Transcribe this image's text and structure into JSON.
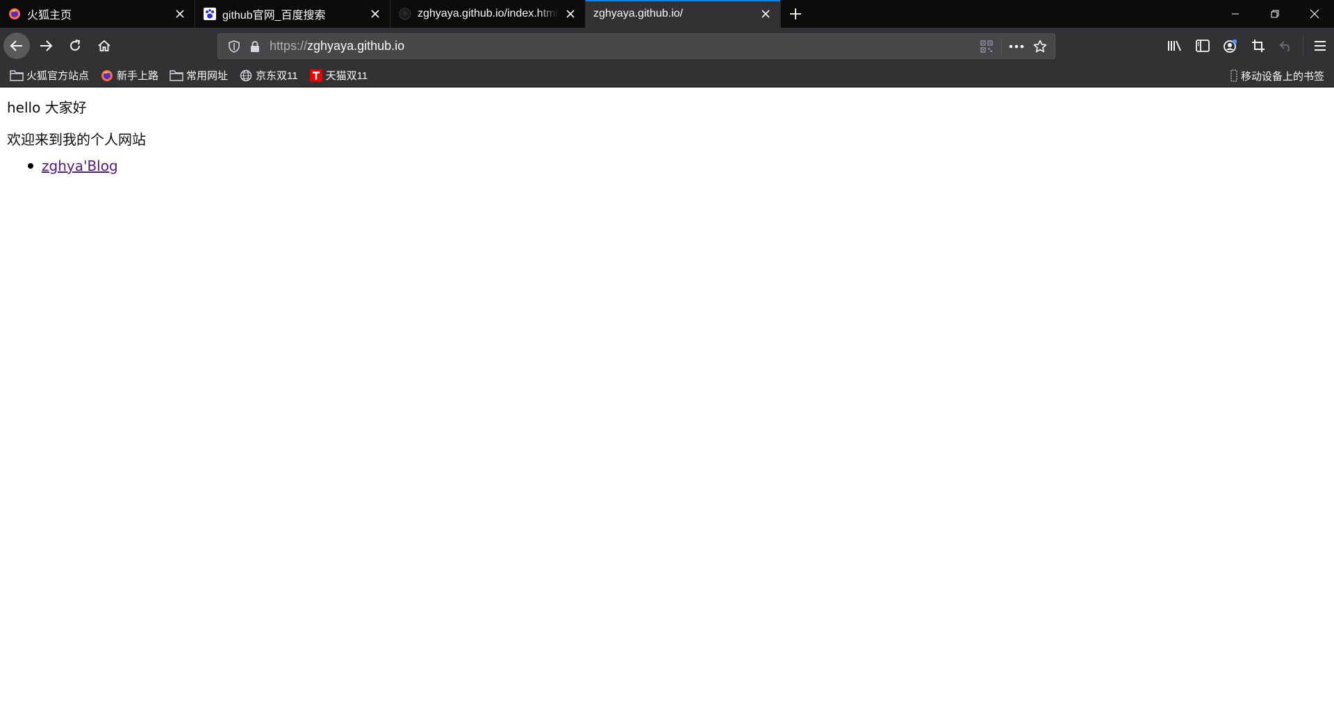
{
  "tabs": [
    {
      "title": "火狐主页",
      "favicon": "firefox-icon",
      "active": false
    },
    {
      "title": "github官网_百度搜索",
      "favicon": "baidu-paw-icon",
      "active": false
    },
    {
      "title": "zghyaya.github.io/index.html",
      "favicon": "github-icon",
      "active": false
    },
    {
      "title": "zghyaya.github.io/",
      "favicon": "",
      "active": true
    }
  ],
  "navbar": {
    "url_scheme": "https://",
    "url_host": "zghyaya.github.io"
  },
  "bookmarks": {
    "items": [
      {
        "label": "火狐官方站点",
        "icon": "folder-icon"
      },
      {
        "label": "新手上路",
        "icon": "firefox-icon"
      },
      {
        "label": "常用网址",
        "icon": "folder-icon"
      },
      {
        "label": "京东双11",
        "icon": "globe-icon"
      },
      {
        "label": "天猫双11",
        "icon": "tmall-icon"
      }
    ],
    "mobile_label": "移动设备上的书签"
  },
  "page": {
    "greeting": "hello 大家好",
    "welcome": "欢迎来到我的个人网站",
    "links": [
      {
        "label": "zghya'Blog"
      }
    ]
  },
  "colors": {
    "tab_accent": "#0a84ff",
    "visited_link": "#551a8b",
    "toolbar_bg": "#323234",
    "tabstrip_bg": "#0c0c0d"
  }
}
